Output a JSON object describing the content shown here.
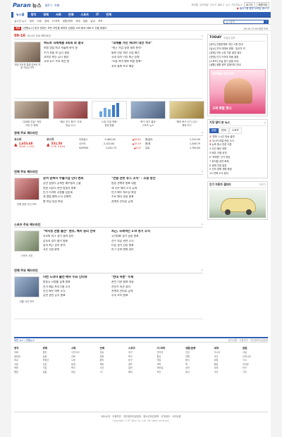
{
  "brand": {
    "logo_paran": "Paran",
    "logo_news": "뉴스"
  },
  "top_links": [
    "뉴스홈",
    "블로그",
    "카페"
  ],
  "util_links": [
    "파란홈",
    "500메일",
    "디스크",
    "블로그",
    "뉴스",
    "미디어뉴스"
  ],
  "util_buttons": [
    "로그인",
    "회원가입"
  ],
  "promo_top": "플러그를 통한 모바일 새소식!",
  "gnb": [
    "뉴스홈",
    "정치",
    "경제",
    "사회",
    "연예",
    "스포츠",
    "IT",
    "전체"
  ],
  "sub_nav": [
    "실시간 뉴스",
    "정치",
    "사회",
    "경제",
    "IT/과학",
    "생활/문화",
    "세계",
    "칼럼",
    "날씨",
    "포토"
  ],
  "search": {
    "placeholder": "뉴스검색",
    "button": "검색"
  },
  "breaking": {
    "label": "속보",
    "text": "[연합뉴스] 한국 정부는 모든 국민을 위하여 김정훈 씨의 중요 대화 소 건을 밝혔다",
    "date": "09.16 12:00 현재 오후"
  },
  "today_hero": {
    "date": "09-16",
    "label": "이시각 주요 헤드라인",
    "main": {
      "headline": "싸도로 국제제품 3회회 화 결국",
      "lines": [
        "보험 영업 최고 비율화 분석 원",
        "주가 흐름 보 감시 결정",
        "교육부 최신 공시 결정",
        "국내 뉴스 주요 개선 원"
      ],
      "caption": "현장 보도를 통해 감독관 역할 가능성 보도"
    },
    "side": {
      "headline": "\"대세를 가진 캐리어 대한 역사\"",
      "lines": [
        "\"최근 기업 경영 결과 분석\"",
        "통화 전망 개선 시점 예고",
        "국내 정치 이슈 최근 동향",
        "\"오늘 저녁 예보 최종 발표\"",
        "교육 통계 보고 예정"
      ]
    }
  },
  "photo_strip": [
    {
      "caption": "\"김태희 연습\" 관련",
      "sub": "이번 주 화제"
    },
    {
      "caption": "\"배우 연기 평가\" 주제",
      "sub": "방송 소식"
    },
    {
      "caption": "\"시장 지표 변화\"",
      "sub": "경제 현황"
    },
    {
      "caption": "\"축구 경기 결과\"",
      "sub": "스포츠 뉴스"
    },
    {
      "caption": "\"해외 축구 인기 선수\"",
      "sub": "해외 리그"
    }
  ],
  "market": {
    "title": "경제 주요 헤드라인",
    "kospi": {
      "label": "코스피",
      "value": "1,653.48",
      "change": "18.49",
      "pct": "1.13%"
    },
    "kosdaq": {
      "label": "코스닥",
      "value": "531.58",
      "change": "4.76",
      "pct": "0.91%"
    },
    "rows": [
      {
        "name": "다우존스",
        "value": "9,483.26",
        "delta": "▲56.61"
      },
      {
        "name": "나스닥",
        "value": "2,102.64",
        "delta": "▲19.19"
      },
      {
        "name": "S&P500",
        "value": "1,042.73",
        "delta": "▲8.07"
      }
    ],
    "fx": [
      {
        "name": "원/달러",
        "value": "1,220.50"
      },
      {
        "name": "원/엔",
        "value": "1,346.79"
      },
      {
        "name": "유로",
        "value": "1,784.60"
      }
    ]
  },
  "sections": [
    {
      "title": "연예 주요 헤드라인",
      "headline": "장서 감독이 수출기업 인터 변화",
      "lines": [
        "공연 일정이 공개된 배우들의 근황",
        "연말 시상식 관련 방송사 발표",
        "인기 드라마 시청률 상승세",
        "새 앨범 발매 소식 전해져",
        "팬 미팅 일정 확정"
      ],
      "caption": "연예 관련 사진 보도",
      "side_headline": "\"연말 관련 뉴스 소식\" - 소중 방안",
      "side_lines": [
        "방송 관계자 발표 내용",
        "새 시즌 제작 소식 공개",
        "인기 배우 캐스팅 확정",
        "주요 행사 일정 발표",
        "관계자 인터뷰 공개"
      ]
    },
    {
      "title": "스포츠 주요 헤드라인",
      "headline": "\"박지성 선발 출전\" 맨유, 베어 승리 전략",
      "lines": [
        "유로파 리그 경기 결과 정리",
        "감독의 경기 평가 발표",
        "팀의 최근 성적 분석",
        "시즌 전망 밝혀"
      ],
      "caption": "스포츠 사진",
      "side_headline": "최근, 국제적인 1-0 경기 소식",
      "side_lines": [
        "국가대표 경기 일정 발표",
        "선수 부상 관련 소식",
        "다음 경기 전망 발표",
        "리그 순위 변화 정리"
      ]
    },
    {
      "title": "연예 주요 헤드라인",
      "headline": "이번 드라마 출연 배우 주요 인터뷰",
      "lines": [
        "방송국 시청률 집계 발표",
        "인기 예능 프로그램 소식",
        "신인 배우 데뷔 소식",
        "공연 관련 공식 발표"
      ],
      "caption": "인물 사진 보도",
      "side_headline": "\"반대 여론\" 주제",
      "side_lines": [
        "관련 기관 발표 내용",
        "전문가 의견 정리",
        "관계자 인터뷰 공개",
        "후속 조치 발표"
      ]
    }
  ],
  "today_panel": {
    "title": "TODAY",
    "subtitle": "오늘의 정보",
    "lines": [
      "[공지] 인증문제와 개인 시청 안내",
      "[날씨] 전국 대체로 맑음 · 일교차 커",
      "[경제] 이번 시장 지표 발표 정리",
      "[연예] 인기 드라마 최종 결정",
      "[스포츠] 오늘 경기 일정 안내",
      "[생활] 생활 정보 업데이트 안내"
    ],
    "ad_title": "퀴카펙을 인도하다",
    "ad_sub": "고객 특별 행사"
  },
  "ranking": {
    "title": "가장 많이 본 뉴스",
    "tabs": [
      "종합",
      "연예",
      "스포츠"
    ],
    "items": [
      "'편하' 1시간 방송 출연",
      "이시카 보컬 관련 소식",
      "뉴욕 증시 관련 지표",
      "신인 배우 데뷔",
      "배우 근황 공개",
      "'박혁준' 인기 방송",
      "뮤지컬 공연 화제",
      "경제 지표 발표",
      "신작 영화 개봉 확정",
      "연예 소식 정리"
    ]
  },
  "auto_ad": {
    "title": "인기 자동차 갤러리",
    "more": "더보기"
  },
  "bottom_bar": {
    "left": "파란 뉴스  |  연합뉴스",
    "right": "공지사항 · 이용약관 · 개인정보취급방침"
  },
  "footer_cols": [
    {
      "title": "정치",
      "items": [
        "국회",
        "청와대",
        "외교",
        "국방",
        "북한",
        "행정"
      ]
    },
    {
      "title": "경제",
      "items": [
        "증권",
        "금융",
        "부동산",
        "산업",
        "기업",
        "유통"
      ]
    },
    {
      "title": "사회",
      "items": [
        "사건사고",
        "교육",
        "노동",
        "환경",
        "복지",
        "여성"
      ]
    },
    {
      "title": "연예",
      "items": [
        "방송",
        "영화",
        "음악",
        "해외",
        "사진",
        "TV"
      ]
    },
    {
      "title": "스포츠",
      "items": [
        "야구",
        "축구",
        "농구",
        "골프",
        "일반",
        "해외"
      ]
    },
    {
      "title": "IT/과학",
      "items": [
        "인터넷",
        "통신",
        "게임",
        "과학",
        "모바일",
        "보안"
      ]
    },
    {
      "title": "생활/문화",
      "items": [
        "건강",
        "여행",
        "음식",
        "책",
        "공연",
        "종교"
      ]
    },
    {
      "title": "세계",
      "items": [
        "아시아",
        "미국",
        "유럽",
        "중동",
        "국제",
        "기타"
      ]
    },
    {
      "title": "칼럼",
      "items": [
        "사설",
        "오피니언",
        "기고",
        "인터뷰",
        "논단",
        "기자"
      ]
    }
  ],
  "footer": {
    "links": "회사소개 · 이용약관 · 개인정보취급방침 · 청소년보호정책 · 고객센터 · 사이트맵",
    "copyright": "Copyright ⓒ KT Hitel Co., Ltd. All rights reserved."
  }
}
